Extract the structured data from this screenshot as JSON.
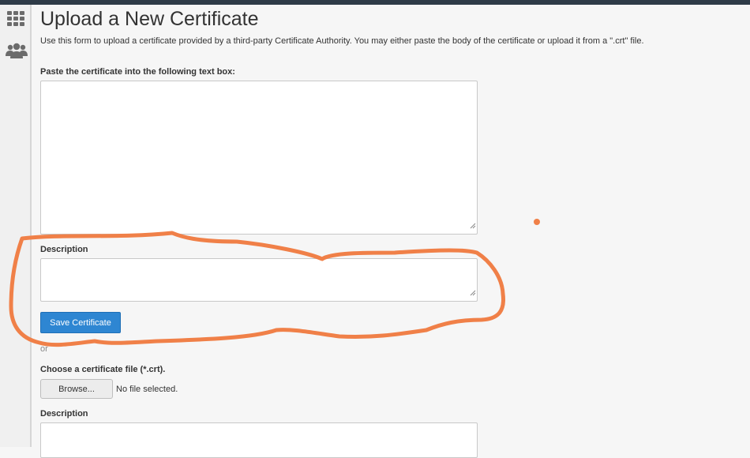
{
  "page": {
    "title": "Upload a New Certificate",
    "intro": "Use this form to upload a certificate provided by a third-party Certificate Authority. You may either paste the body of the certificate or upload it from a \".crt\" file."
  },
  "sidebar": {
    "icons": [
      "grid-icon",
      "users-icon"
    ]
  },
  "paste_form": {
    "label": "Paste the certificate into the following text box:",
    "certificate_value": "",
    "description_label": "Description",
    "description_value": "",
    "save_label": "Save Certificate"
  },
  "separator": {
    "text": "or"
  },
  "upload_form": {
    "file_label": "Choose a certificate file (*.crt).",
    "browse_label": "Browse...",
    "file_status": "No file selected.",
    "description_label": "Description",
    "description_value": ""
  },
  "colors": {
    "accent": "#2e86d2",
    "annotation": "#f08048"
  }
}
